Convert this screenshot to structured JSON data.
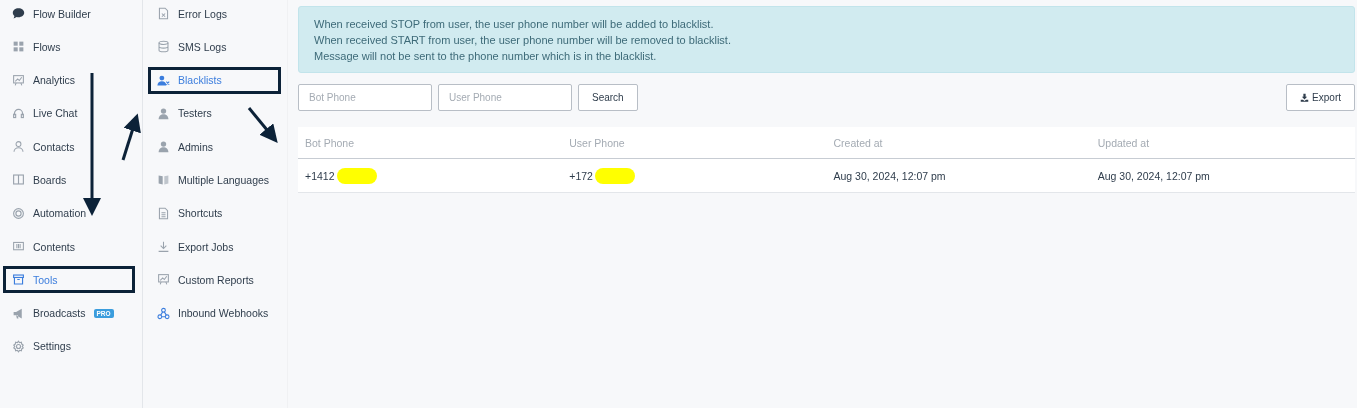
{
  "nav": [
    {
      "label": "Flow Builder",
      "selected": false
    },
    {
      "label": "Flows",
      "selected": false
    },
    {
      "label": "Analytics",
      "selected": false
    },
    {
      "label": "Live Chat",
      "selected": false
    },
    {
      "label": "Contacts",
      "selected": false
    },
    {
      "label": "Boards",
      "selected": false
    },
    {
      "label": "Automation",
      "selected": false
    },
    {
      "label": "Contents",
      "selected": false
    },
    {
      "label": "Tools",
      "selected": true
    },
    {
      "label": "Broadcasts",
      "selected": false,
      "badge": "PRO"
    },
    {
      "label": "Settings",
      "selected": false
    }
  ],
  "submenu": [
    {
      "label": "Error Logs",
      "selected": false
    },
    {
      "label": "SMS Logs",
      "selected": false
    },
    {
      "label": "Blacklists",
      "selected": true
    },
    {
      "label": "Testers",
      "selected": false
    },
    {
      "label": "Admins",
      "selected": false
    },
    {
      "label": "Multiple Languages",
      "selected": false
    },
    {
      "label": "Shortcuts",
      "selected": false
    },
    {
      "label": "Export Jobs",
      "selected": false
    },
    {
      "label": "Custom Reports",
      "selected": false
    },
    {
      "label": "Inbound Webhooks",
      "selected": false
    }
  ],
  "notice": [
    "When received STOP from user, the user phone number will be added to blacklist.",
    "When received START from user, the user phone number will be removed to blacklist.",
    "Message will not be sent to the phone number which is in the blacklist."
  ],
  "filters": {
    "bot_phone": {
      "placeholder": "Bot Phone"
    },
    "user_phone": {
      "placeholder": "User Phone"
    },
    "search_button": "Search",
    "export_button": "Export"
  },
  "table": {
    "columns": [
      "Bot Phone",
      "User Phone",
      "Created at",
      "Updated at"
    ],
    "rows": [
      {
        "bot_phone": "+1412",
        "user_phone": "+172",
        "created_at": "Aug 30, 2024, 12:07 pm",
        "updated_at": "Aug 30, 2024, 12:07 pm",
        "redacted": true
      }
    ]
  }
}
